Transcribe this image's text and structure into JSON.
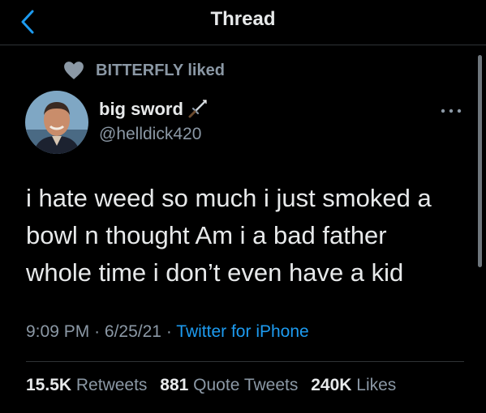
{
  "header": {
    "title": "Thread"
  },
  "social_context": {
    "text": "BITTERFLY liked"
  },
  "author": {
    "name": "big sword",
    "handle": "@helldick420"
  },
  "tweet": {
    "lines": [
      "i hate weed so much i just smoked a",
      "bowl n thought Am i a bad father",
      "whole time i don’t even have a kid"
    ]
  },
  "meta": {
    "time": "9:09 PM",
    "sep": "·",
    "date": "6/25/21",
    "source": "Twitter for iPhone"
  },
  "stats": {
    "retweets_count": "15.5K",
    "retweets_label": "Retweets",
    "quotes_count": "881",
    "quotes_label": "Quote Tweets",
    "likes_count": "240K",
    "likes_label": "Likes"
  },
  "colors": {
    "background": "#000000",
    "text": "#e7e9ea",
    "secondary": "#8b98a5",
    "accent": "#1d9bf0"
  },
  "icons": [
    "back-chevron-icon",
    "heart-icon",
    "sword-icon",
    "more-icon"
  ]
}
